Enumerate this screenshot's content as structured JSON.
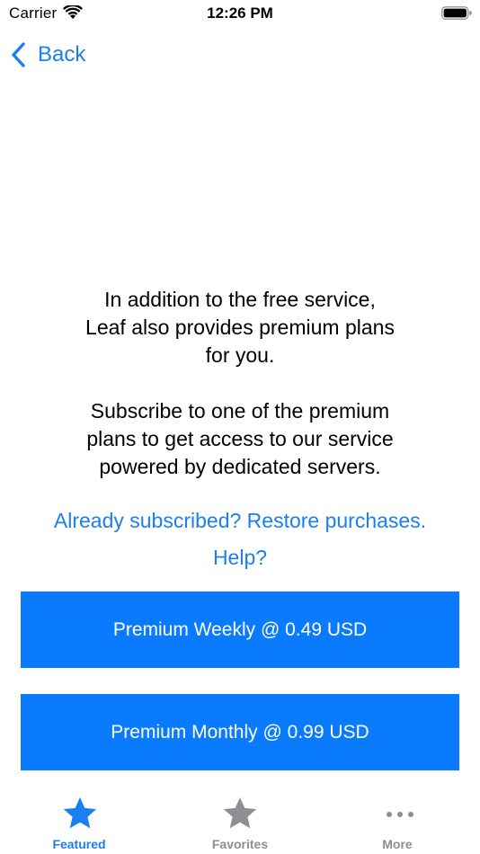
{
  "status_bar": {
    "carrier": "Carrier",
    "time": "12:26 PM"
  },
  "nav": {
    "back_label": "Back",
    "back_icon": "chevron-left-icon"
  },
  "content": {
    "message": "In addition to the free service,\nLeaf also provides premium plans\nfor you.\n\nSubscribe to one of the premium\nplans to get access to our service\npowered by dedicated servers.",
    "restore_link": "Already subscribed? Restore purchases.",
    "help_link": "Help?"
  },
  "plans": {
    "weekly_label": "Premium Weekly @ 0.49 USD",
    "monthly_label": "Premium Monthly @ 0.99 USD"
  },
  "tab_bar": {
    "tabs": [
      {
        "label": "Featured",
        "icon": "star-icon",
        "selected": true
      },
      {
        "label": "Favorites",
        "icon": "star-icon",
        "selected": false
      },
      {
        "label": "More",
        "icon": "ellipsis-icon",
        "selected": false
      }
    ]
  },
  "colors": {
    "accent": "#1a7ff0",
    "button_fill": "#0a7bff",
    "inactive_tab": "#8e8e93"
  }
}
